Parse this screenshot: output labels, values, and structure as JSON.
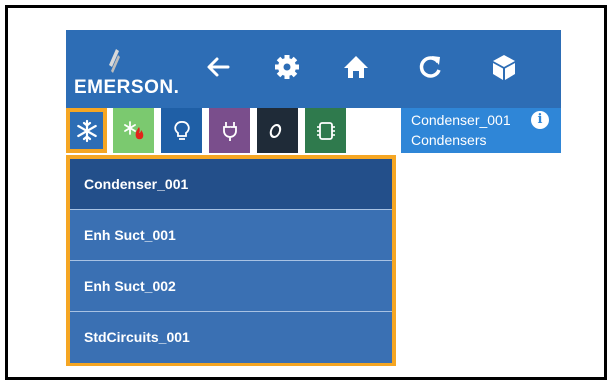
{
  "logo": {
    "text": "EMERSON."
  },
  "toolbar": {
    "icons": [
      "back-arrow-icon",
      "gear-icon",
      "home-icon",
      "refresh-icon",
      "cube-icon"
    ]
  },
  "tabs": [
    {
      "name": "refrigeration",
      "color": "#2d6db5",
      "icon": "snowflake-icon"
    },
    {
      "name": "hvac",
      "color": "#7bc96f",
      "icon": "snowflake-flame-icon"
    },
    {
      "name": "lighting",
      "color": "#1f5fa6",
      "icon": "lightbulb-icon"
    },
    {
      "name": "power",
      "color": "#7a4e8c",
      "icon": "plug-icon"
    },
    {
      "name": "other",
      "color": "#1f2b38",
      "icon": "o-icon",
      "label": "O"
    },
    {
      "name": "circuits",
      "color": "#2f7a4d",
      "icon": "chip-icon"
    }
  ],
  "device": {
    "name": "Condenser_001",
    "group": "Condensers"
  },
  "dropdown": {
    "items": [
      {
        "label": "Condenser_001",
        "selected": true
      },
      {
        "label": "Enh Suct_001",
        "selected": false
      },
      {
        "label": "Enh Suct_002",
        "selected": false
      },
      {
        "label": "StdCircuits_001",
        "selected": false
      }
    ]
  },
  "colors": {
    "toolbar": "#2d6db5",
    "accent_border": "#f5a623",
    "info_bar": "#2f86d7",
    "menu_bg": "#3a70b3",
    "menu_selected": "#234f8a"
  }
}
